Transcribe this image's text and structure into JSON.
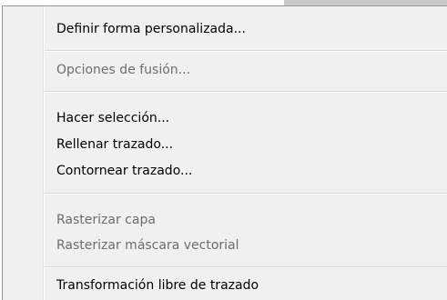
{
  "menu": {
    "items": [
      {
        "label": "Definir forma personalizada...",
        "enabled": true
      },
      {
        "label": "Opciones de fusión...",
        "enabled": false
      },
      {
        "label": "Hacer selección...",
        "enabled": true
      },
      {
        "label": "Rellenar trazado...",
        "enabled": true
      },
      {
        "label": "Contornear trazado...",
        "enabled": true
      },
      {
        "label": "Rasterizar capa",
        "enabled": false
      },
      {
        "label": "Rasterizar máscara vectorial",
        "enabled": false
      },
      {
        "label": "Transformación libre de trazado",
        "enabled": true
      }
    ]
  }
}
